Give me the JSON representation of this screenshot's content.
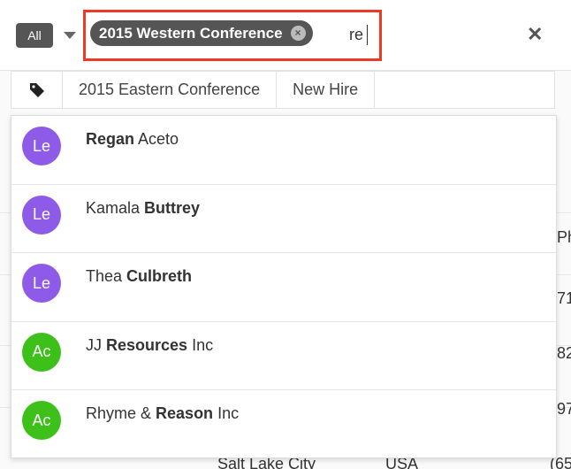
{
  "search": {
    "module_label": "All",
    "tag_pill_label": "2015 Western Conference",
    "pill_remove_glyph": "×",
    "query": "re",
    "close_glyph": "✕"
  },
  "tags_row": {
    "icon": "tag-icon",
    "items": [
      "2015 Eastern Conference",
      "New Hire"
    ]
  },
  "results": [
    {
      "initials": "Le",
      "color": "#8e5be8",
      "pre": "",
      "bold": "Regan",
      "post": " Aceto"
    },
    {
      "initials": "Le",
      "color": "#8e5be8",
      "pre": "Kamala ",
      "bold": "Buttrey",
      "post": ""
    },
    {
      "initials": "Le",
      "color": "#8e5be8",
      "pre": "Thea ",
      "bold": "Culbreth",
      "post": ""
    },
    {
      "initials": "Ac",
      "color": "#3dc11a",
      "pre": "JJ ",
      "bold": "Resources",
      "post": " Inc"
    },
    {
      "initials": "Ac",
      "color": "#3dc11a",
      "pre": "Rhyme & ",
      "bold": "Reason",
      "post": " Inc"
    }
  ],
  "background": {
    "fragments": [
      "Ph",
      "71",
      "82",
      "97",
      "Salt Lake City",
      "USA",
      "(65"
    ]
  },
  "colors": {
    "highlight_border": "#ee3a23",
    "pill_background": "#555555",
    "lead_avatar": "#8e5be8",
    "account_avatar": "#3dc11a"
  }
}
